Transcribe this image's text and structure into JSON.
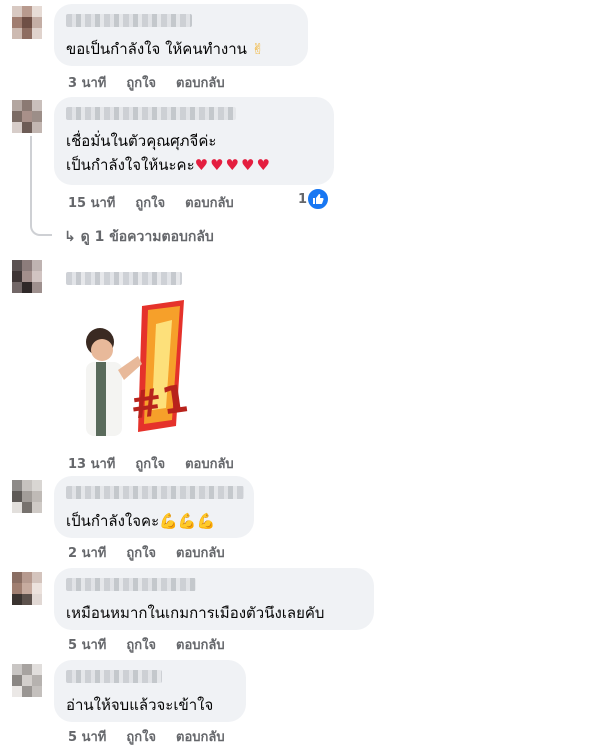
{
  "comments": [
    {
      "text": "ขอเป็นกำลังใจ ให้คนทำงาน",
      "emoji": "✌",
      "time": "3 นาที",
      "like": "ถูกใจ",
      "reply": "ตอบกลับ"
    },
    {
      "line1": "เชื่อมั่นในตัวคุณศุภจีค่ะ",
      "line2": "เป็นกำลังใจให้นะคะ",
      "hearts": "♥♥♥♥♥",
      "time": "15 นาที",
      "like": "ถูกใจ",
      "reply": "ตอบกลับ",
      "reaction_count": "1",
      "reaction_icon": "thumbs-up"
    },
    {
      "sticker_text": "#1",
      "time": "13 นาที",
      "like": "ถูกใจ",
      "reply": "ตอบกลับ"
    },
    {
      "text": "เป็นกำลังใจคะ",
      "emoji": "💪💪💪",
      "time": "2 นาที",
      "like": "ถูกใจ",
      "reply": "ตอบกลับ"
    },
    {
      "text": "เหมือนหมากในเกมการเมืองตัวนึงเลยคับ",
      "time": "5 นาที",
      "like": "ถูกใจ",
      "reply": "ตอบกลับ"
    },
    {
      "text": "อ่านให้จบแล้วจะเข้าใจ",
      "time": "5 นาที",
      "like": "ถูกใจ",
      "reply": "ตอบกลับ"
    }
  ],
  "view_replies": "ดู 1 ข้อความตอบกลับ",
  "colors": {
    "bubble": "#f0f2f5",
    "meta": "#65676b",
    "like_blue": "#1877f2",
    "heart": "#e41e3f"
  }
}
